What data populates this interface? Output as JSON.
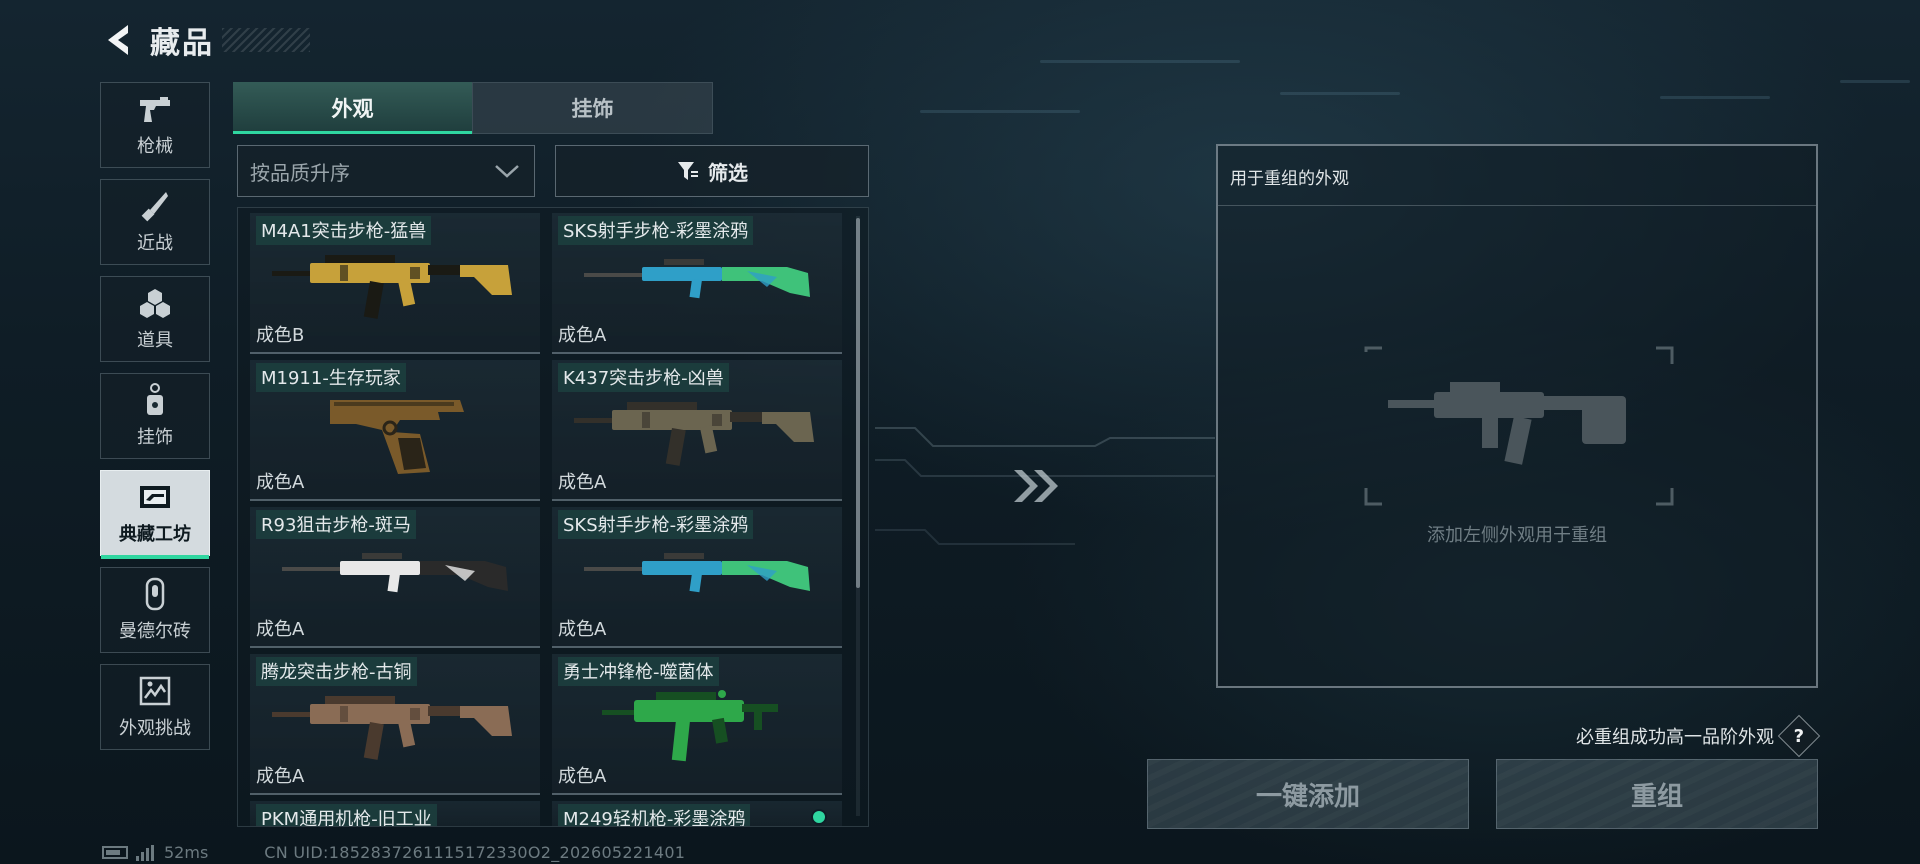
{
  "header": {
    "title": "藏品"
  },
  "nav": [
    {
      "label": "枪械",
      "icon": "pistol-icon"
    },
    {
      "label": "近战",
      "icon": "knife-icon"
    },
    {
      "label": "道具",
      "icon": "grenade-icon"
    },
    {
      "label": "挂饰",
      "icon": "charm-icon"
    },
    {
      "label": "典藏工坊",
      "icon": "workshop-icon",
      "active": true
    },
    {
      "label": "曼德尔砖",
      "icon": "brick-icon"
    },
    {
      "label": "外观挑战",
      "icon": "challenge-icon"
    }
  ],
  "tabs": [
    {
      "label": "外观",
      "active": true
    },
    {
      "label": "挂饰",
      "active": false
    }
  ],
  "sort": {
    "label": "按品质升序"
  },
  "filter": {
    "label": "筛选"
  },
  "items": [
    {
      "name": "M4A1突击步枪-猛兽",
      "grade": "成色B",
      "gun": "rifle",
      "c1": "#c7a13a",
      "c2": "#1a1a14"
    },
    {
      "name": "SKS射手步枪-彩墨涂鸦",
      "grade": "成色A",
      "gun": "sniper",
      "c1": "#2f9fc8",
      "c2": "#3fc27a"
    },
    {
      "name": "M1911-生存玩家",
      "grade": "成色A",
      "gun": "pistol",
      "c1": "#7a5a2a",
      "c2": "#2a2418"
    },
    {
      "name": "K437突击步枪-凶兽",
      "grade": "成色A",
      "gun": "rifle",
      "c1": "#6b6550",
      "c2": "#33302a"
    },
    {
      "name": "R93狙击步枪-斑马",
      "grade": "成色A",
      "gun": "sniper",
      "c1": "#e8e8e8",
      "c2": "#2a2a2a"
    },
    {
      "name": "SKS射手步枪-彩墨涂鸦",
      "grade": "成色A",
      "gun": "sniper",
      "c1": "#2f9fc8",
      "c2": "#3fc27a"
    },
    {
      "name": "腾龙突击步枪-古铜",
      "grade": "成色A",
      "gun": "rifle",
      "c1": "#8a6c55",
      "c2": "#4a3a2e"
    },
    {
      "name": "勇士冲锋枪-噬菌体",
      "grade": "成色A",
      "gun": "smg",
      "c1": "#2ea84a",
      "c2": "#164f22"
    },
    {
      "name": "PKM通用机枪-旧工业",
      "grade": "",
      "gun": "none",
      "c1": "#555",
      "c2": "#333"
    },
    {
      "name": "M249轻机枪-彩墨涂鸦",
      "grade": "",
      "gun": "none",
      "c1": "#555",
      "c2": "#333"
    }
  ],
  "panel": {
    "title": "用于重组的外观",
    "hint": "添加左侧外观用于重组"
  },
  "note": "必重组成功高一品阶外观",
  "buttons": {
    "add": "一键添加",
    "recompose": "重组"
  },
  "status": {
    "ping": "52ms",
    "uid": "CN UID:1852837261115172330O2_202605221401"
  },
  "colors": {
    "accent": "#2fd6a0"
  }
}
